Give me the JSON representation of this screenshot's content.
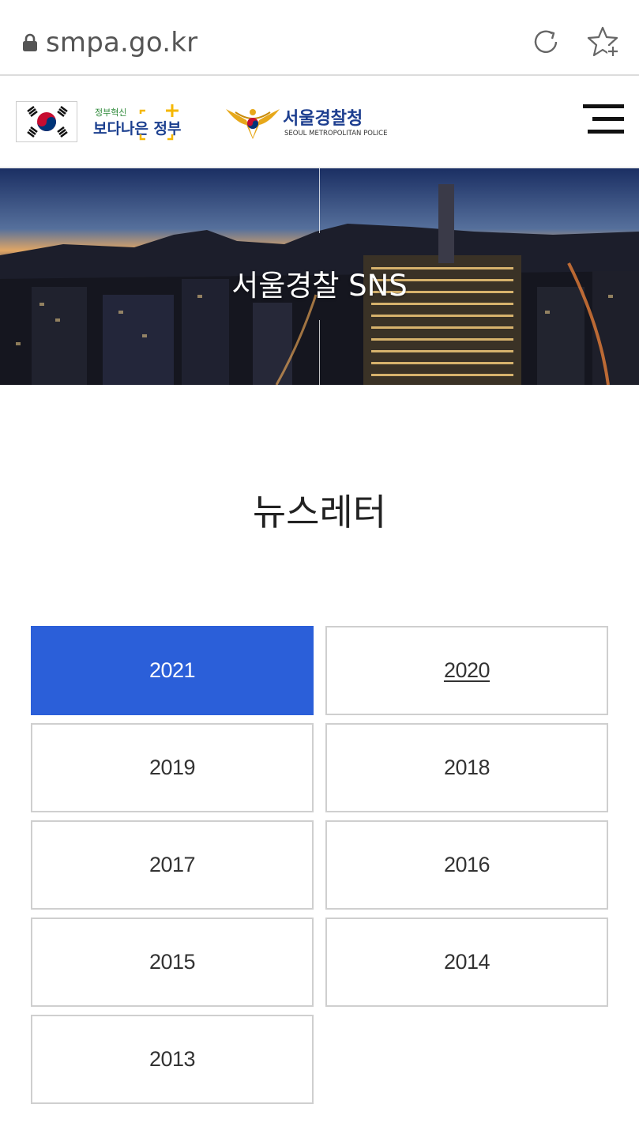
{
  "browser": {
    "url": "smpa.go.kr",
    "icons": [
      "lock-icon",
      "reload-icon",
      "bookmark-add-icon"
    ]
  },
  "header": {
    "gov_logo_small": "정부혁신",
    "gov_logo_big": "보다나은 정부",
    "police_name": "서울경찰청",
    "police_sub": "SEOUL METROPOLITAN POLICE",
    "menu_icon": "hamburger-menu-icon"
  },
  "banner": {
    "title": "서울경찰 SNS"
  },
  "page": {
    "heading": "뉴스레터"
  },
  "years": [
    {
      "label": "2021",
      "state": "active"
    },
    {
      "label": "2020",
      "state": "underlined"
    },
    {
      "label": "2019",
      "state": "default"
    },
    {
      "label": "2018",
      "state": "default"
    },
    {
      "label": "2017",
      "state": "default"
    },
    {
      "label": "2016",
      "state": "default"
    },
    {
      "label": "2015",
      "state": "default"
    },
    {
      "label": "2014",
      "state": "default"
    },
    {
      "label": "2013",
      "state": "default"
    }
  ],
  "colors": {
    "active": "#2b5fd9",
    "border": "#cfcfcf",
    "police_blue": "#1d3e8f"
  }
}
